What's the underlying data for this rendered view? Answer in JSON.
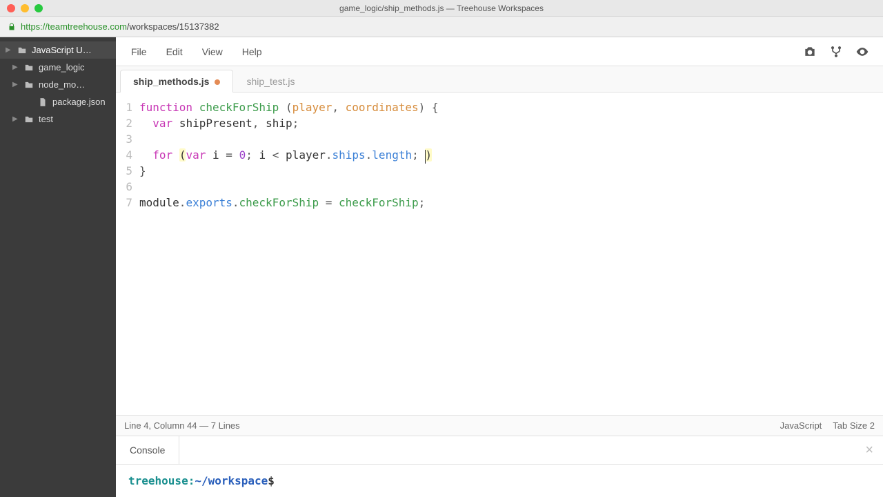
{
  "window": {
    "title": "game_logic/ship_methods.js — Treehouse Workspaces"
  },
  "url": {
    "secure_host": "https://teamtreehouse.com",
    "path": "/workspaces/15137382"
  },
  "sidebar": {
    "items": [
      {
        "label": "JavaScript U…",
        "kind": "folder",
        "expandable": true,
        "level": 0,
        "selected": true
      },
      {
        "label": "game_logic",
        "kind": "folder",
        "expandable": true,
        "level": 1
      },
      {
        "label": "node_mo…",
        "kind": "folder",
        "expandable": true,
        "level": 1
      },
      {
        "label": "package.json",
        "kind": "file",
        "expandable": false,
        "level": 2
      },
      {
        "label": "test",
        "kind": "folder",
        "expandable": true,
        "level": 1
      }
    ]
  },
  "menu": {
    "items": [
      "File",
      "Edit",
      "View",
      "Help"
    ]
  },
  "toolbar_icons": [
    "camera-icon",
    "fork-icon",
    "eye-icon"
  ],
  "tabs": [
    {
      "label": "ship_methods.js",
      "active": true,
      "dirty": true
    },
    {
      "label": "ship_test.js",
      "active": false,
      "dirty": false
    }
  ],
  "code": {
    "lines": [
      [
        "kw:function",
        " ",
        "fn:checkForShip",
        " ",
        "punct:(",
        "param:player",
        "punct:,",
        " ",
        "param:coordinates",
        "punct:)",
        " ",
        "punct:{"
      ],
      [
        "  ",
        "kw:var",
        " ",
        "id:shipPresent",
        "punct:,",
        " ",
        "id:ship",
        "punct:;"
      ],
      [
        ""
      ],
      [
        "  ",
        "kw:for",
        " ",
        "bhl:(",
        "kw:var",
        " ",
        "id:i",
        " ",
        "punct:=",
        " ",
        "num:0",
        "punct:;",
        " ",
        "id:i",
        " ",
        "punct:<",
        " ",
        "id:player",
        "punct:.",
        "prop:ships",
        "punct:.",
        "prop:length",
        "punct:;",
        " ",
        "cursor:",
        "bhl:)"
      ],
      [
        "punct:}"
      ],
      [
        ""
      ],
      [
        "id:module",
        "punct:.",
        "prop:exports",
        "punct:.",
        "fn:checkForShip",
        " ",
        "punct:=",
        " ",
        "fn:checkForShip",
        "punct:;"
      ]
    ]
  },
  "status": {
    "left": "Line 4, Column 44 — 7 Lines",
    "language": "JavaScript",
    "tab_size": "Tab Size  2"
  },
  "console": {
    "tab": "Console",
    "prompt_host": "treehouse:",
    "prompt_path": "~/workspace",
    "prompt_sym": "$"
  }
}
